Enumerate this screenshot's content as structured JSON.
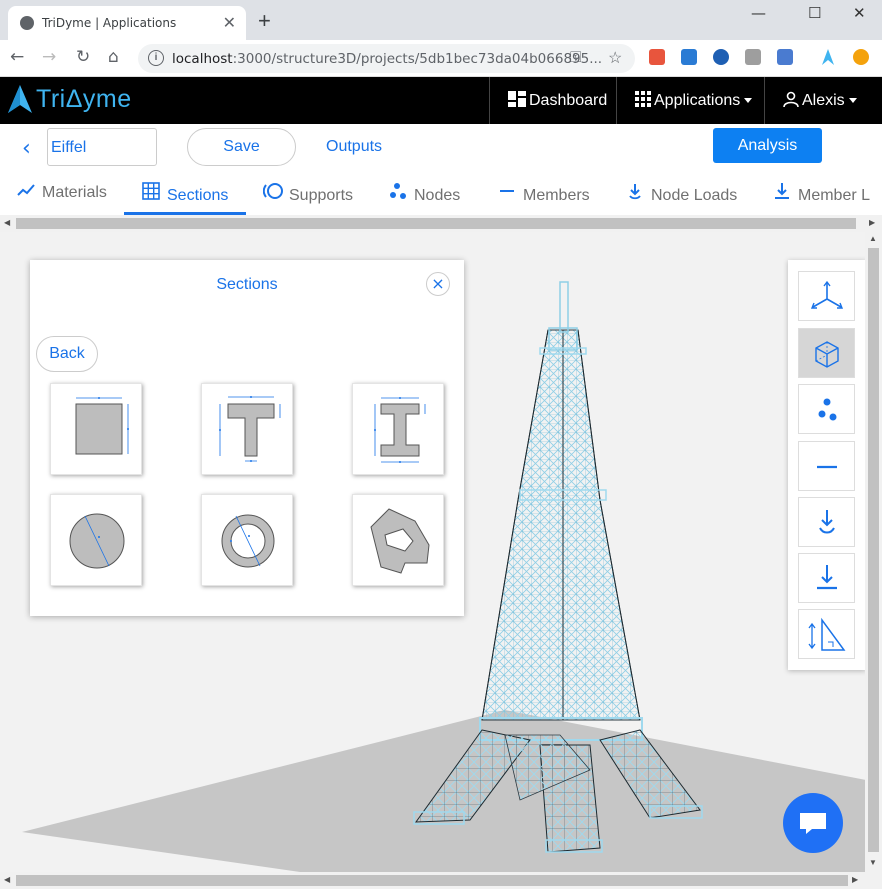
{
  "browser": {
    "tab_title": "TriDyme | Applications",
    "url_host": "localhost",
    "url_path": ":3000/structure3D/projects/5db1bec73da04b066895..."
  },
  "app": {
    "brand": "TriΔyme",
    "nav": {
      "dashboard": "Dashboard",
      "applications": "Applications",
      "user": "Alexis"
    }
  },
  "project": {
    "name": "Eiffel",
    "save_label": "Save",
    "outputs_label": "Outputs",
    "analysis_label": "Analysis"
  },
  "tabs": [
    {
      "label": "Materials",
      "icon": "chart-line-icon"
    },
    {
      "label": "Sections",
      "icon": "grid-icon"
    },
    {
      "label": "Supports",
      "icon": "support-icon"
    },
    {
      "label": "Nodes",
      "icon": "nodes-icon"
    },
    {
      "label": "Members",
      "icon": "member-icon"
    },
    {
      "label": "Node Loads",
      "icon": "node-load-icon"
    },
    {
      "label": "Member L",
      "icon": "member-load-icon"
    }
  ],
  "panel": {
    "title": "Sections",
    "back_label": "Back",
    "sections": [
      "rectangle",
      "t-section",
      "i-section",
      "circle",
      "hollow-circle",
      "polygon"
    ]
  },
  "right_tools": [
    "axes-icon",
    "cube-icon",
    "nodes-icon",
    "member-icon",
    "node-load-icon",
    "member-load-icon",
    "dimension-icon"
  ],
  "colors": {
    "accent": "#1a73e8",
    "appbar": "#000000",
    "brand": "#3fb4f0",
    "structure": "#9fd9ee"
  }
}
